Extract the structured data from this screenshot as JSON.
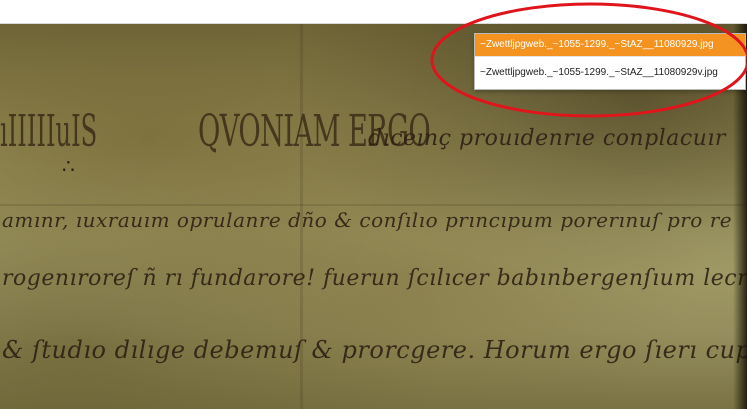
{
  "file_dropdown": {
    "items": [
      {
        "label": "~Zwettljpgweb._~1055-1299._~StAZ__11080929.jpg",
        "selected": true
      },
      {
        "label": "~Zwettljpgweb._~1055-1299._~StAZ__11080929v.jpg",
        "selected": false
      }
    ],
    "highlight_color": "#f4931f"
  },
  "annotation": {
    "shape": "ellipse",
    "color": "#e0151b"
  },
  "document_image": {
    "script_lines": [
      "dıceınç prouıdenrıe conplacuır",
      "amınr, ıuxrauım oprulanre dño & conſılıo prıncıpum porerınuſ pro re",
      "rogenıroreſ ñ rı fundarore!  fuerun ſcılıcer babınbergenſıum lecram",
      "& ſtudıo dılıge debemuſ & prorcgere. Horum ergo ſıerı cupımuſ"
    ],
    "capitals": "QVONIAM ERGO",
    "margin_mark": "ıIIIIIuIS",
    "cross_mark": "∴"
  }
}
